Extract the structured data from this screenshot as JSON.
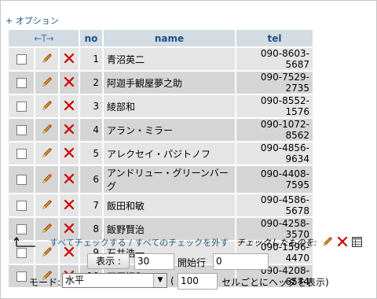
{
  "options": {
    "plus": "+",
    "label": "オプション"
  },
  "header": {
    "no": "no",
    "name": "name",
    "tel": "tel"
  },
  "rows": [
    {
      "no": "1",
      "name": "青沼英二",
      "tel": "090-8603-5687"
    },
    {
      "no": "2",
      "name": "阿迦手観屋夢之助",
      "tel": "090-7529-2735"
    },
    {
      "no": "3",
      "name": "綾部和",
      "tel": "090-8552-1576"
    },
    {
      "no": "4",
      "name": "アラン・ミラー",
      "tel": "090-1072-8562"
    },
    {
      "no": "5",
      "name": "アレクセイ・パジトノフ",
      "tel": "090-4856-9634"
    },
    {
      "no": "6",
      "name": "アンドリュー・グリーンバーグ",
      "tel": "090-4408-7595"
    },
    {
      "no": "7",
      "name": "飯田和敏",
      "tel": "090-4586-5678"
    },
    {
      "no": "8",
      "name": "飯野賢治",
      "tel": "090-4258-3570"
    },
    {
      "no": "9",
      "name": "石井浩一",
      "tel": "090-1596-4470"
    },
    {
      "no": "10",
      "name": "石原恒和",
      "tel": "090-4208-6574"
    }
  ],
  "bulk": {
    "check_all": "すべてチェックする",
    "separator": "/",
    "uncheck_all": "すべてのチェックを外す",
    "with_checked": "チェックしたものを:"
  },
  "nav": {
    "show_button": "表示 :",
    "rows_value": "30",
    "start_label": "開始行",
    "start_value": "0"
  },
  "mode": {
    "label": "モード:",
    "selected": "水平",
    "paren_open": "(",
    "repeat_value": "100",
    "suffix": "セルごとにヘッダを表示)"
  },
  "colors": {
    "link": "#235a81",
    "header_bg": "#d3dce3",
    "row_odd": "#e5e5e5",
    "row_even": "#d5d5d5",
    "delete_red": "#cc0000"
  },
  "icons": {
    "edit": "pencil-icon",
    "delete": "red-x-icon",
    "export": "export-table-icon",
    "check_all_arrow": "corner-arrow-icon"
  }
}
